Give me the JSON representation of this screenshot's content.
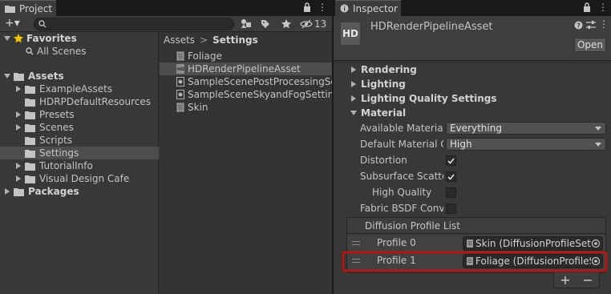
{
  "project": {
    "tab_label": "Project",
    "search_placeholder": "",
    "hidden_count": "13",
    "add_label": "+▾",
    "favorites": {
      "label": "Favorites",
      "items": [
        "All Scenes"
      ]
    },
    "assets": {
      "label": "Assets",
      "items": [
        "ExampleAssets",
        "HDRPDefaultResources",
        "Presets",
        "Scenes",
        "Scripts",
        "Settings",
        "TutorialInfo",
        "Visual Design Cafe"
      ]
    },
    "packages_label": "Packages",
    "breadcrumb": {
      "root": "Assets",
      "sep": ">",
      "current": "Settings"
    },
    "files": [
      "Foliage",
      "HDRenderPipelineAsset",
      "SampleScenePostProcessingSettings",
      "SampleSceneSkyandFogSettings",
      "Skin"
    ]
  },
  "inspector": {
    "tab_label": "Inspector",
    "icon_text": "HD",
    "asset_title": "HDRenderPipelineAsset",
    "open_label": "Open",
    "sections": [
      "Rendering",
      "Lighting",
      "Lighting Quality Settings",
      "Material"
    ],
    "material": {
      "available_material_label": "Available Material",
      "available_material_value": "Everything",
      "default_material_label": "Default Material Quality",
      "default_material_value": "High",
      "distortion_label": "Distortion",
      "subsurface_label": "Subsurface Scattering",
      "high_quality_label": "High Quality",
      "fabric_label": "Fabric BSDF Convolution"
    },
    "diffusion": {
      "header": "Diffusion Profile List",
      "rows": [
        {
          "label": "Profile 0",
          "value": "Skin (DiffusionProfileSettings)"
        },
        {
          "label": "Profile 1",
          "value": "Foliage (DiffusionProfileSettings)"
        }
      ],
      "add": "+",
      "remove": "−"
    }
  },
  "colors": {
    "highlight": "#e00000",
    "selection": "#4d4d4d"
  }
}
